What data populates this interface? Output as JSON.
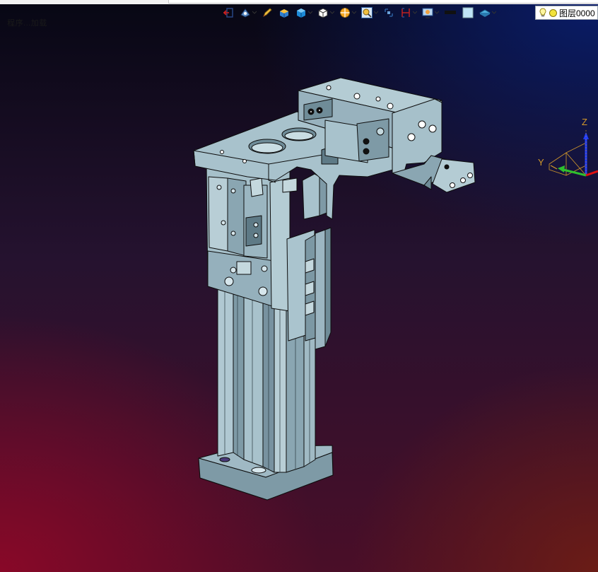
{
  "status": {
    "prompt_text": "ﾠ程序...加载",
    "layer_label": "图层0000"
  },
  "toolbar": {
    "icons": [
      "exit-sketch-icon",
      "view-orient-icon",
      "pencil-icon",
      "solid-box-icon",
      "shaded-cube-icon",
      "wireframe-cube-icon",
      "render-style-icon",
      "zoom-fit-icon",
      "section-view-icon",
      "measure-icon",
      "display-settings-icon",
      "line-color-icon",
      "face-color-icon",
      "material-icon",
      "light-bulb-icon"
    ]
  },
  "axes": {
    "z_label": "Z",
    "y_label": "Y"
  },
  "colors": {
    "part": "#9fb9c4",
    "part_dark": "#6f8c98",
    "part_light": "#c4d8de",
    "edge": "#0d0d0d",
    "axis_z": "#1e3cff",
    "axis_y": "#2ec02e",
    "axis_x": "#e01010",
    "axis_label": "#d49a2a"
  }
}
